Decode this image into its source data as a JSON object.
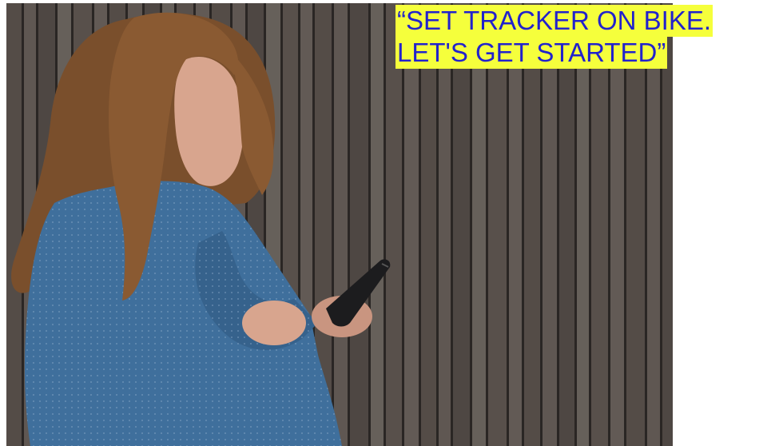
{
  "caption": {
    "line1": "“SET TRACKER ON BIKE.",
    "line2": "LET'S GET STARTED”",
    "text_color": "#2222cc",
    "highlight_color": "#f5ff3c"
  },
  "photo": {
    "subject": "woman-with-phone",
    "colors": {
      "fence": "#5c5550",
      "shirt": "#3f6f9c",
      "hair": "#8a5a32",
      "skin": "#d8a58e",
      "phone": "#1c1c1e"
    }
  }
}
